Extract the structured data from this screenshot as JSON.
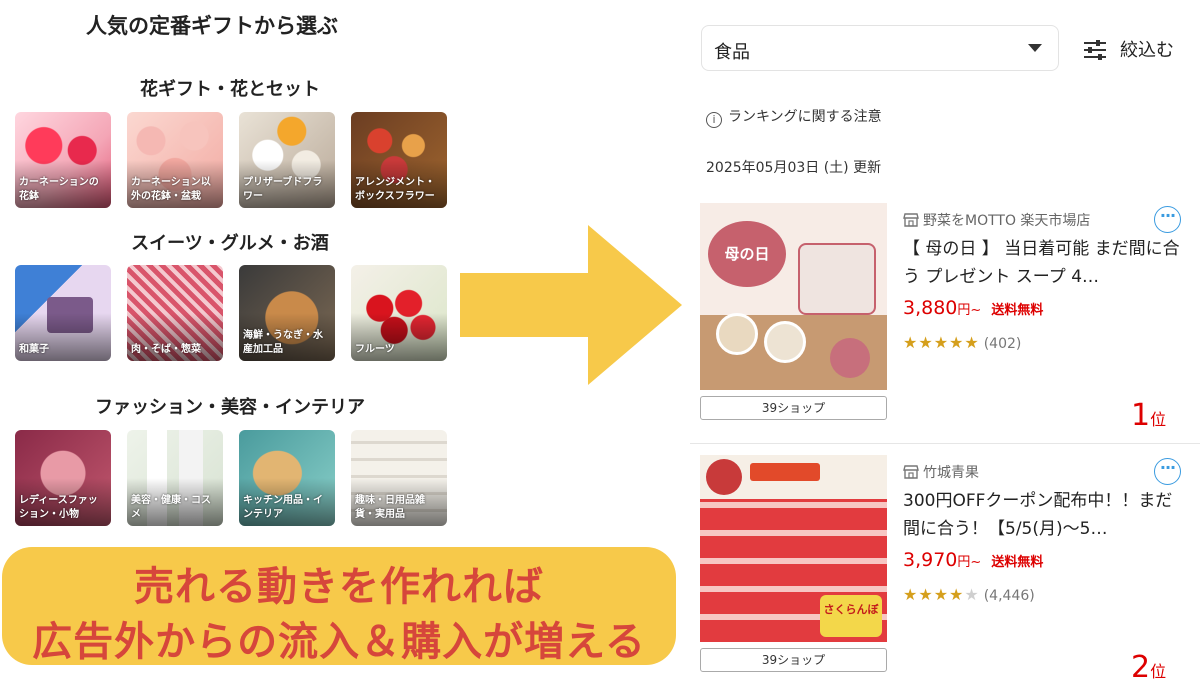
{
  "left": {
    "title": "人気の定番ギフトから選ぶ",
    "sections": [
      {
        "title": "花ギフト・花とセット",
        "tiles": [
          {
            "label": "カーネーションの花鉢"
          },
          {
            "label": "カーネーション以外の花鉢・盆栽"
          },
          {
            "label": "プリザーブドフラワー"
          },
          {
            "label": "アレンジメント・ボックスフラワー"
          }
        ]
      },
      {
        "title": "スイーツ・グルメ・お酒",
        "tiles": [
          {
            "label": "和菓子"
          },
          {
            "label": "肉・そば・惣菜"
          },
          {
            "label": "海鮮・うなぎ・水産加工品"
          },
          {
            "label": "フルーツ"
          }
        ]
      },
      {
        "title": "ファッション・美容・インテリア",
        "tiles": [
          {
            "label": "レディースファッション・小物"
          },
          {
            "label": "美容・健康・コスメ"
          },
          {
            "label": "キッチン用品・インテリア"
          },
          {
            "label": "趣味・日用品雑貨・実用品"
          }
        ]
      }
    ]
  },
  "banner": {
    "line1": "売れる動きを作れれば",
    "line2": "広告外からの流入＆購入が増える"
  },
  "right": {
    "category_select": "食品",
    "filter_label": "絞込む",
    "notice": "ランキングに関する注意",
    "updated": "2025年05月03日 (土) 更新",
    "items": [
      {
        "store": "野菜をMOTTO 楽天市場店",
        "name": "【 母の日 】 当日着可能 まだ間に合う プレゼント スープ 4…",
        "price": "3,880",
        "yen": "円~",
        "shipping": "送料無料",
        "stars": "★★★★★",
        "rating": 4.5,
        "reviews": "(402)",
        "shop_count": "39ショップ",
        "rank": "1",
        "rank_unit": "位",
        "photo_text": "母の日"
      },
      {
        "store": "竹城青果",
        "name": "300円OFFクーポン配布中！！まだ間に合う！【5/5(月)〜5…",
        "price": "3,970",
        "yen": "円~",
        "shipping": "送料無料",
        "stars": "★★★★★",
        "rating": 4.0,
        "reviews": "(4,446)",
        "shop_count": "39ショップ",
        "rank": "2",
        "rank_unit": "位",
        "photo_text": "さくらんぼ"
      }
    ]
  },
  "colors": {
    "banner_bg": "#f7c94a",
    "banner_text": "#d6463b",
    "arrow": "#f7c94a",
    "price": "#dd0000",
    "star": "#d59f1c",
    "more_button": "#3a9be0"
  }
}
